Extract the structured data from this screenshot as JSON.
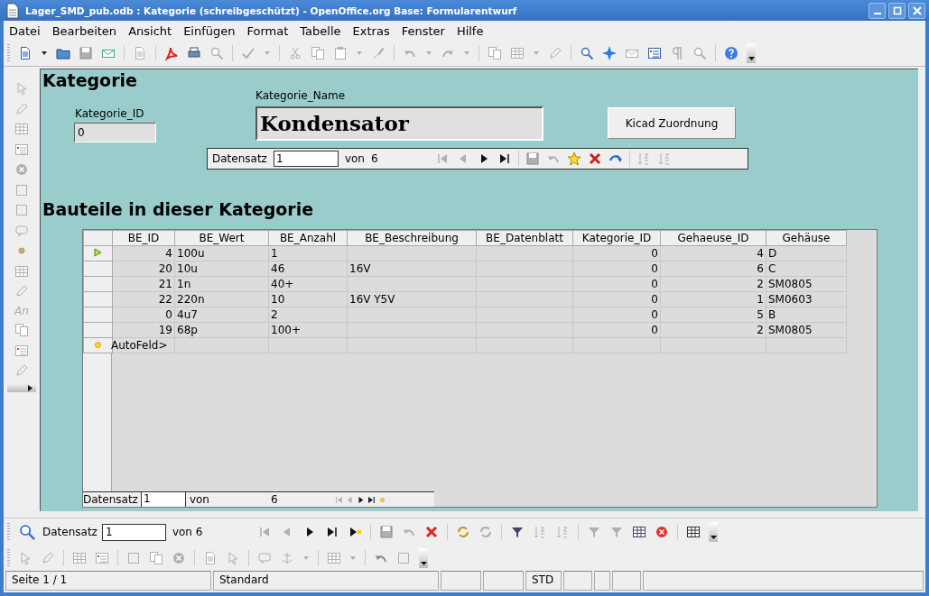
{
  "window": {
    "title": "Lager_SMD_pub.odb : Kategorie (schreibgeschützt) - OpenOffice.org Base: Formularentwurf"
  },
  "menu": [
    "Datei",
    "Bearbeiten",
    "Ansicht",
    "Einfügen",
    "Format",
    "Tabelle",
    "Extras",
    "Fenster",
    "Hilfe"
  ],
  "form": {
    "heading": "Kategorie",
    "id_field": {
      "label": "Kategorie_ID",
      "value": "0"
    },
    "name_field": {
      "label": "Kategorie_Name",
      "value": "Kondensator"
    },
    "button": "Kicad Zuordnung",
    "navigator": {
      "label": "Datensatz",
      "value": "1",
      "of": "von",
      "total": "6"
    },
    "subheading": "Bauteile in dieser Kategorie",
    "grid": {
      "columns": [
        {
          "label": "BE_ID",
          "numeric": true
        },
        {
          "label": "BE_Wert",
          "numeric": false
        },
        {
          "label": "BE_Anzahl",
          "numeric": false
        },
        {
          "label": "BE_Beschreibung",
          "numeric": false
        },
        {
          "label": "BE_Datenblatt"
        },
        {
          "label": "Kategorie_ID",
          "numeric": true
        },
        {
          "label": "Gehaeuse_ID",
          "numeric": true
        },
        {
          "label": "Gehäuse",
          "numeric": false
        }
      ],
      "rows": [
        {
          "kind": "record",
          "current": true,
          "cells": [
            "4",
            "100u",
            "1",
            null,
            null,
            "0",
            "4",
            "D"
          ]
        },
        {
          "kind": "record",
          "current": false,
          "cells": [
            "20",
            "10u",
            "46",
            "16V",
            null,
            "0",
            "6",
            "C"
          ]
        },
        {
          "kind": "record",
          "current": false,
          "cells": [
            "21",
            "1n",
            "40+",
            null,
            null,
            "0",
            "2",
            "SM0805"
          ]
        },
        {
          "kind": "record",
          "current": false,
          "cells": [
            "22",
            "220n",
            "10",
            "16V Y5V",
            null,
            "0",
            "1",
            "SM0603"
          ]
        },
        {
          "kind": "record",
          "current": false,
          "cells": [
            "0",
            "4u7",
            "2",
            null,
            null,
            "0",
            "5",
            "B"
          ]
        },
        {
          "kind": "record",
          "current": false,
          "cells": [
            "19",
            "68p",
            "100+",
            null,
            null,
            "0",
            "2",
            "SM0805"
          ]
        },
        {
          "kind": "new",
          "current": false,
          "cells": [
            "AutoFeld>"
          ]
        }
      ],
      "navigator": {
        "label": "Datensatz",
        "value": "1",
        "of": "von",
        "total": "6"
      }
    }
  },
  "left_toolbar": {
    "text_icon": "An"
  },
  "record_bar": {
    "label": "Datensatz",
    "value": "1",
    "of": "von 6"
  },
  "status_bar": {
    "page": "Seite 1 / 1",
    "style": "Standard",
    "mode": "STD"
  }
}
